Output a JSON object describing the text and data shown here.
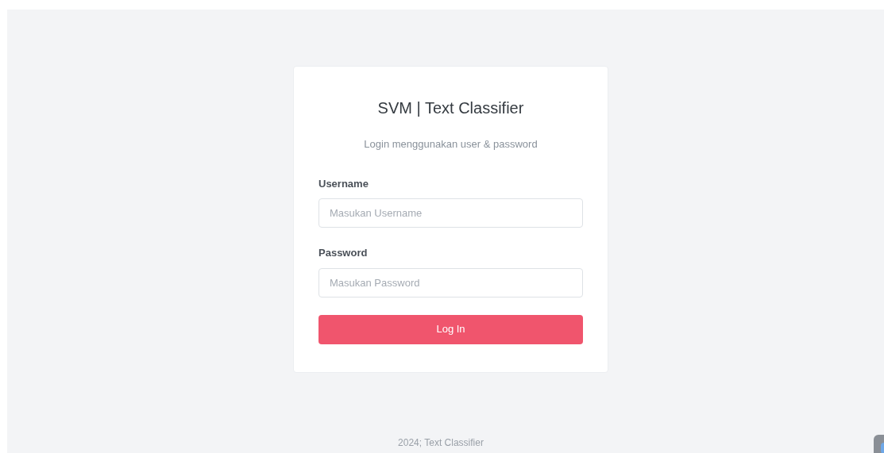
{
  "card": {
    "title": "SVM | Text Classifier",
    "subtitle": "Login menggunakan user & password",
    "fields": [
      {
        "label": "Username",
        "placeholder": "Masukan Username"
      },
      {
        "label": "Password",
        "placeholder": "Masukan Password"
      }
    ],
    "button": "Log In"
  },
  "footer": "2024; Text Classifier"
}
